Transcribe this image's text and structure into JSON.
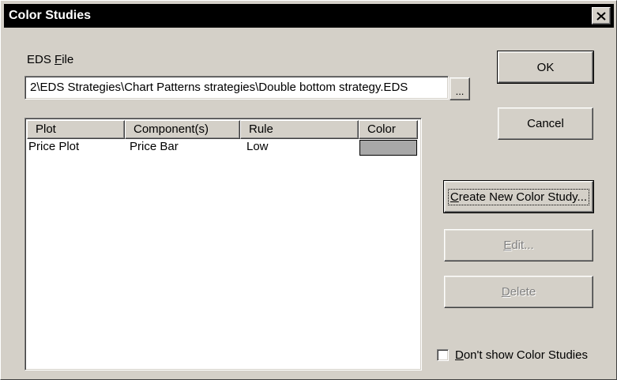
{
  "window": {
    "title": "Color Studies",
    "close_icon": "close-icon"
  },
  "eds_file": {
    "label_prefix": "EDS ",
    "label_mnemonic": "F",
    "label_rest": "ile",
    "path_value": "2\\EDS Strategies\\Chart Patterns strategies\\Double bottom strategy.EDS",
    "browse_label": "..."
  },
  "list": {
    "columns": [
      "Plot",
      "Component(s)",
      "Rule",
      "Color"
    ],
    "rows": [
      {
        "plot": "Price Plot",
        "component": "Price Bar",
        "rule": "Low",
        "color": "#a8a8a8"
      }
    ]
  },
  "buttons": {
    "ok": "OK",
    "cancel": "Cancel",
    "create_mnemonic": "C",
    "create_rest": "reate New Color Study...",
    "edit_mnemonic": "E",
    "edit_rest": "dit...",
    "delete_mnemonic": "D",
    "delete_rest": "elete"
  },
  "options": {
    "dont_show_mnemonic": "D",
    "dont_show_rest": "on't show Color Studies",
    "dont_show_checked": false
  }
}
